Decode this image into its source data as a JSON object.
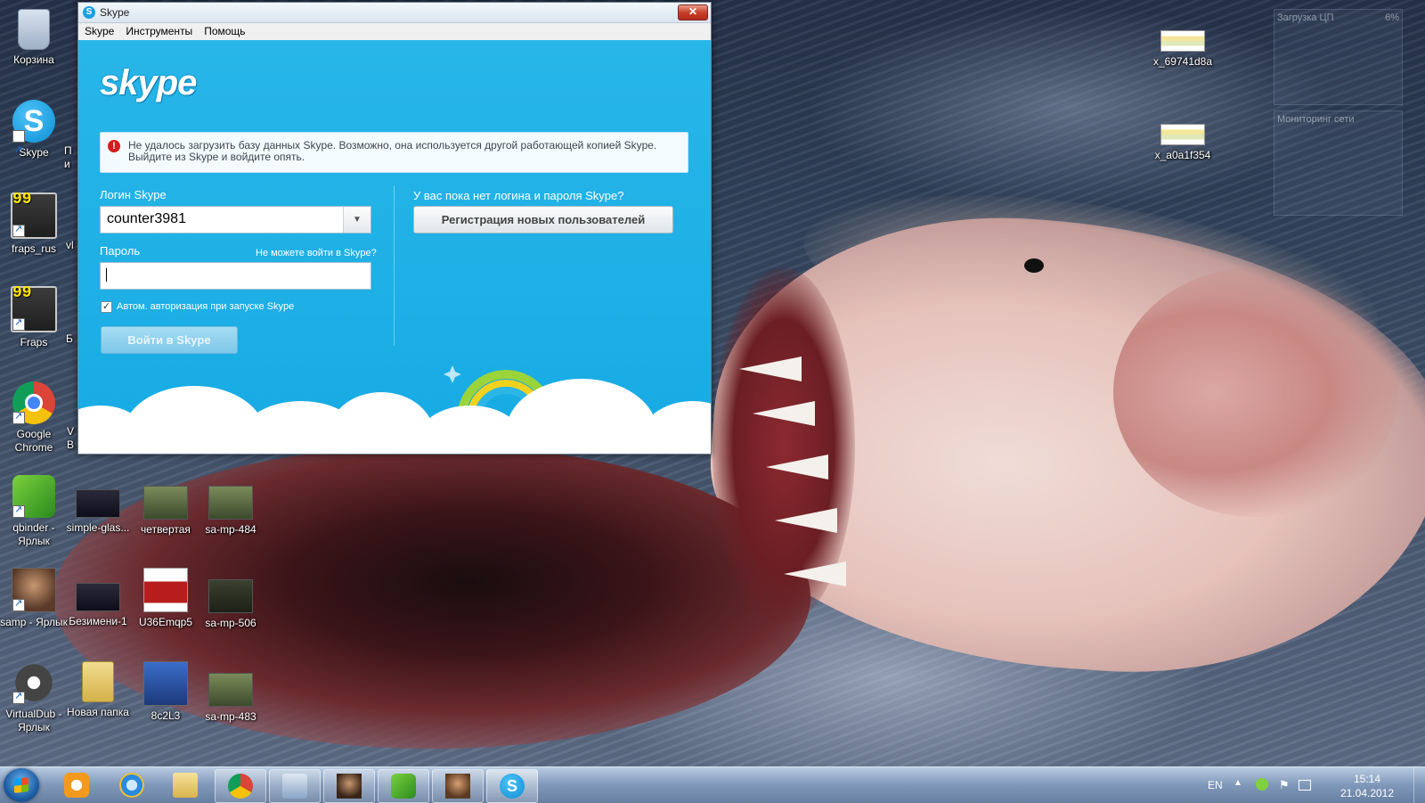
{
  "desktop": {
    "icons": [
      {
        "label": "Корзина"
      },
      {
        "label": "Skype"
      },
      {
        "label": "fraps_rus"
      },
      {
        "label": "Fraps"
      },
      {
        "label": "Google Chrome"
      },
      {
        "label": "qbinder - Ярлык"
      },
      {
        "label": "samp - Ярлык"
      },
      {
        "label": "VirtualDub - Ярлык"
      },
      {
        "label": "simple-glas..."
      },
      {
        "label": "четвертая"
      },
      {
        "label": "sa-mp-484"
      },
      {
        "label": "Безимени-1"
      },
      {
        "label": "U36Emqp5"
      },
      {
        "label": "sa-mp-506"
      },
      {
        "label": "Новая папка"
      },
      {
        "label": "8c2L3"
      },
      {
        "label": "sa-mp-483"
      },
      {
        "label": "x_69741d8a"
      },
      {
        "label": "x_a0a1f354"
      }
    ],
    "partial_labels": [
      "П",
      "и",
      "vl",
      "Б",
      "V",
      "B"
    ],
    "gadget": {
      "cpu_title": "Загрузка ЦП",
      "cpu_value": "6%",
      "net_title": "Мониторинг сети"
    }
  },
  "skype_window": {
    "title": "Skype",
    "close_label": "✕",
    "menu": [
      {
        "label": "Skype"
      },
      {
        "label": "Инструменты"
      },
      {
        "label": "Помощь"
      }
    ],
    "logo_text": "skype",
    "error_icon": "!",
    "error_message": "Не удалось загрузить базу данных Skype. Возможно, она используется другой работающей копией Skype. Выйдите из Skype и войдите опять.",
    "login": {
      "label": "Логин Skype",
      "value": "counter3981",
      "dropdown_icon": "▼"
    },
    "password": {
      "label": "Пароль",
      "forgot_link": "Не можете войти в Skype?"
    },
    "autologin": {
      "checked": true,
      "check_glyph": "✓",
      "label": "Автом. авторизация при запуске Skype"
    },
    "signin_button": "Войти в Skype",
    "register": {
      "question": "У вас пока нет логина и пароля Skype?",
      "button": "Регистрация новых пользователей"
    },
    "colors": {
      "background": "#17abe4",
      "error_icon": "#d61c1c"
    }
  },
  "taskbar": {
    "pinned": [
      {
        "icon": "media-player-icon"
      },
      {
        "icon": "internet-explorer-icon"
      },
      {
        "icon": "explorer-folder-icon"
      },
      {
        "icon": "chrome-icon"
      },
      {
        "icon": "control-panel-icon"
      },
      {
        "icon": "samp-icon"
      },
      {
        "icon": "qbinder-icon"
      },
      {
        "icon": "samp-avatar-icon"
      },
      {
        "icon": "skype-icon",
        "active": true
      }
    ],
    "tray": {
      "language": "EN",
      "show_hidden_arrow": "▲",
      "time": "15:14",
      "date": "21.04.2012"
    }
  }
}
